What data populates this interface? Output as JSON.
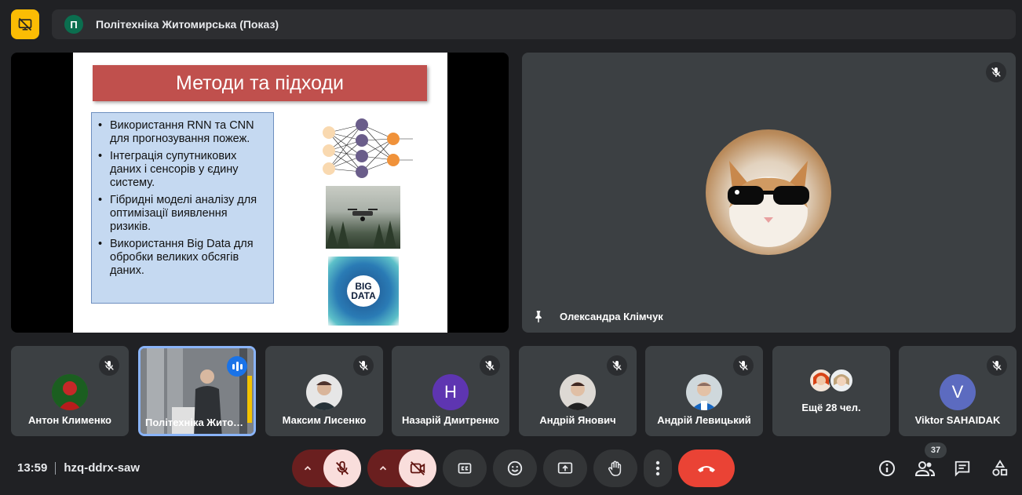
{
  "header": {
    "presenting_icon": "present-off-icon",
    "meeting_avatar_letter": "П",
    "meeting_title": "Політехніка Житомирська (Показ)"
  },
  "slide": {
    "title": "Методи та підходи",
    "bullets": [
      "Використання RNN та CNN для прогнозування пожеж.",
      "Інтеграція супутникових даних і сенсорів у єдину систему.",
      "Гібридні моделі аналізу для оптимізації виявлення ризиків.",
      "Використання Big Data для обробки великих обсягів даних."
    ],
    "bigdata_line1": "BIG",
    "bigdata_line2": "DATA"
  },
  "pinned": {
    "name": "Олександра Клімчук",
    "muted": true
  },
  "participants": [
    {
      "name": "Антон Клименко",
      "avatar": "photo",
      "muted": true
    },
    {
      "name": "Політехніка Житомирська",
      "avatar": "video",
      "speaking": true
    },
    {
      "name": "Максим Лисенко",
      "avatar": "photo",
      "muted": true
    },
    {
      "name": "Назарій Дмитренко",
      "avatar_letter": "Н",
      "avatar_color": "#5e35b1",
      "muted": true
    },
    {
      "name": "Андрій Янович",
      "avatar": "photo",
      "muted": true
    },
    {
      "name": "Андрій Левицький",
      "avatar": "photo",
      "muted": true
    },
    {
      "name": "Ещё 28 чел.",
      "avatar": "stack"
    },
    {
      "name": "Viktor SAHAIDAK",
      "avatar_letter": "V",
      "avatar_color": "#5c6bc0",
      "muted": true
    }
  ],
  "footer": {
    "time": "13:59",
    "meeting_code": "hzq-ddrx-saw",
    "people_count": "37"
  },
  "colors": {
    "background": "#202124",
    "tile": "#3c4043",
    "end_call": "#ea4335",
    "accent_yellow": "#fbbc04",
    "speaking_blue": "#1a73e8"
  }
}
